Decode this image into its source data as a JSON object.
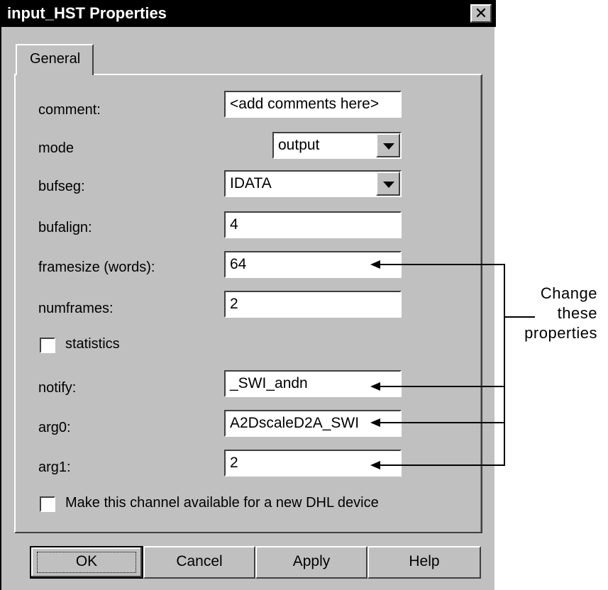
{
  "window": {
    "title": "input_HST Properties",
    "close_glyph": "✕"
  },
  "tabs": [
    {
      "label": "General"
    }
  ],
  "fields": {
    "comment": {
      "label": "comment:",
      "value": "<add comments here>"
    },
    "mode": {
      "label": "mode",
      "value": "output"
    },
    "bufseg": {
      "label": "bufseg:",
      "value": "IDATA"
    },
    "bufalign": {
      "label": "bufalign:",
      "value": "4"
    },
    "framesize": {
      "label": "framesize (words):",
      "value": "64"
    },
    "numframes": {
      "label": "numframes:",
      "value": "2"
    },
    "notify": {
      "label": "notify:",
      "value": "_SWI_andn"
    },
    "arg0": {
      "label": "arg0:",
      "value": "A2DscaleD2A_SWI"
    },
    "arg1": {
      "label": "arg1:",
      "value": "2"
    }
  },
  "checkboxes": {
    "statistics": {
      "label": "statistics",
      "checked": false
    },
    "dhl": {
      "label": "Make this channel available for a new DHL device",
      "checked": false
    }
  },
  "buttons": {
    "ok": "OK",
    "cancel": "Cancel",
    "apply": "Apply",
    "help": "Help"
  },
  "annotation": {
    "line1": "Change",
    "line2": "these",
    "line3": "properties"
  }
}
